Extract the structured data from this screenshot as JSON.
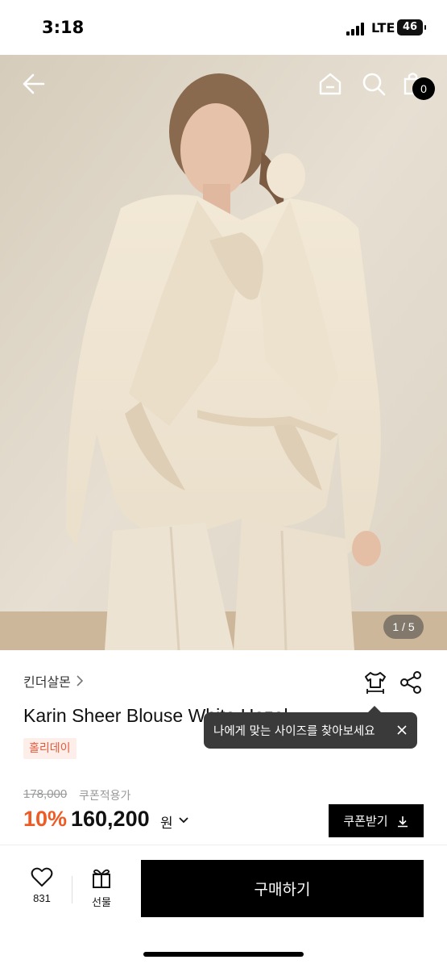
{
  "status_bar": {
    "time": "3:18",
    "network": "LTE",
    "battery": "46"
  },
  "header": {
    "cart_count": "0"
  },
  "gallery": {
    "indicator": "1 / 5"
  },
  "product": {
    "brand": "킨더살몬",
    "brand_chevron": "›",
    "title": "Karin Sheer Blouse White Hazel",
    "badge": "홀리데이",
    "original_price": "178,000",
    "coupon_label": "쿠폰적용가",
    "discount": "10%",
    "price": "160,200",
    "currency": "원"
  },
  "tooltip": {
    "text": "나에게 맞는 사이즈를 찾아보세요"
  },
  "coupon_button": {
    "label": "쿠폰받기"
  },
  "bottom_bar": {
    "like_count": "831",
    "gift_label": "선물",
    "buy_label": "구매하기"
  },
  "colors": {
    "accent": "#ef5b24",
    "badge_text": "#e35b3d",
    "badge_bg": "#fdeee9",
    "primary_button": "#000000"
  }
}
